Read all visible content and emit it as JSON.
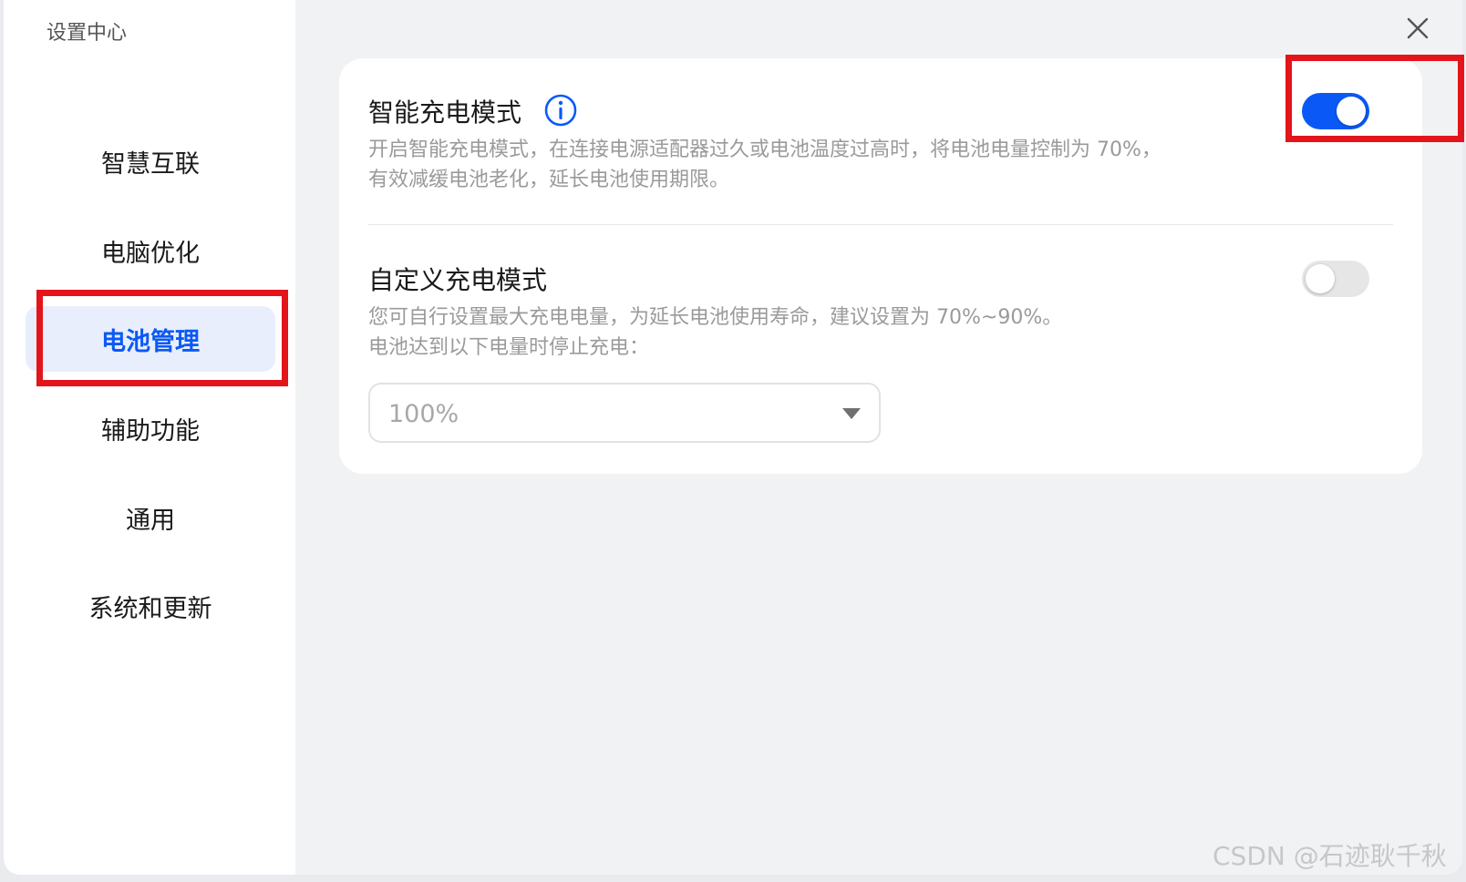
{
  "app_title": "设置中心",
  "sidebar": {
    "items": [
      {
        "label": "智慧互联",
        "active": false
      },
      {
        "label": "电脑优化",
        "active": false
      },
      {
        "label": "电池管理",
        "active": true
      },
      {
        "label": "辅助功能",
        "active": false
      },
      {
        "label": "通用",
        "active": false
      },
      {
        "label": "系统和更新",
        "active": false
      }
    ]
  },
  "smart_charging": {
    "title": "智能充电模式",
    "desc_line1": "开启智能充电模式，在连接电源适配器过久或电池温度过高时，将电池电量控制为 70%，",
    "desc_line2": "有效减缓电池老化，延长电池使用期限。",
    "enabled": true
  },
  "custom_charging": {
    "title": "自定义充电模式",
    "desc_line1": "您可自行设置最大充电电量，为延长电池使用寿命，建议设置为 70%~90%。",
    "desc_line2": "电池达到以下电量时停止充电：",
    "enabled": false,
    "select_value": "100%"
  },
  "icons": {
    "close": "close-icon",
    "info": "info-icon",
    "dropdown": "chevron-down-icon"
  },
  "colors": {
    "accent": "#0a59f7",
    "highlight": "#e3141a"
  },
  "watermark": "CSDN @石迹耿千秋"
}
